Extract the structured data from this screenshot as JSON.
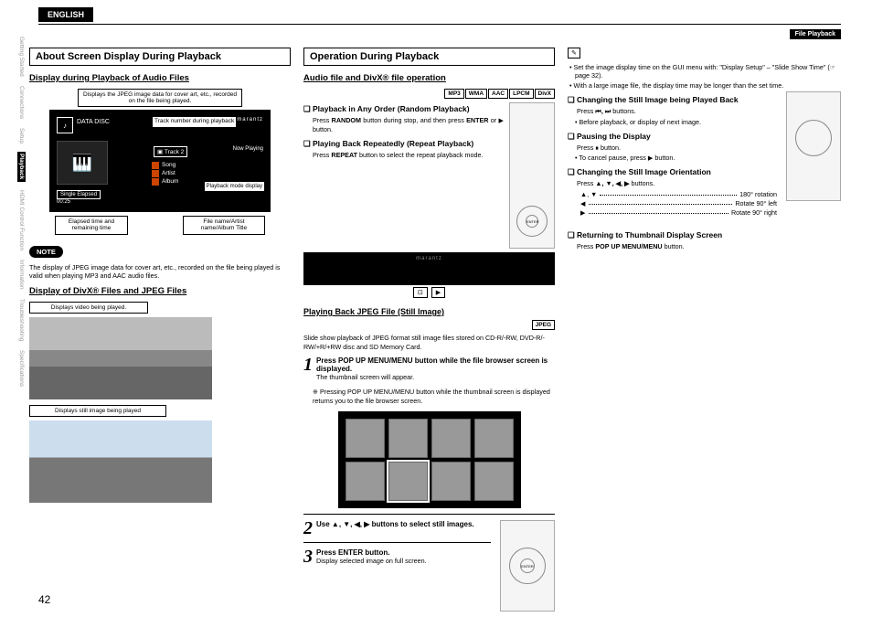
{
  "lang": "ENGLISH",
  "fileplayback": "File Playback",
  "pagenum": "42",
  "sidebar": {
    "items": [
      "Getting Started",
      "Connections",
      "Setup",
      "Playback",
      "HDMI Control Function",
      "Information",
      "Troubleshooting",
      "Specifications"
    ]
  },
  "col1": {
    "title": "About Screen Display During Playback",
    "sub1": "Display during Playback of Audio Files",
    "callout_top": "Displays the JPEG image data for cover art, etc., recorded on the file being played.",
    "display": {
      "disc": "DATA DISC",
      "tracknum": "Track number during playback",
      "track": "Track 2",
      "now": "Now Playing",
      "song": "Song",
      "artist": "Artist",
      "album": "Album",
      "se_label": "Single Elapsed",
      "se_time": "00:25",
      "pbmode": "Playback mode display",
      "brand": "marantz"
    },
    "under": {
      "a": "Elapsed time and remaining time",
      "b": "File name/Artist name/Album Title"
    },
    "note": "NOTE",
    "notetxt": "The display of JPEG image data for cover art, etc., recorded on the file being played is valid when playing MP3 and AAC audio files.",
    "sub2": "Display of DivX® Files and JPEG Files",
    "v_call": "Displays video being played.",
    "s_call": "Displays still image being played"
  },
  "col2": {
    "title": "Operation During Playback",
    "sub1": "Audio file and DivX® file operation",
    "fmts": [
      "MP3",
      "WMA",
      "AAC",
      "LPCM",
      "DivX"
    ],
    "q1": "Playback in Any Order (Random Playback)",
    "q1t": "Press RANDOM button during stop, and then press ENTER or ▶ button.",
    "q2": "Playing Back Repeatedly (Repeat Playback)",
    "q2t": "Press REPEAT button to select the repeat playback mode.",
    "brand": "marantz",
    "sub2": "Playing Back JPEG File (Still Image)",
    "fmt2": "JPEG",
    "slidetxt": "Slide show playback of JPEG format still image files stored on CD-R/-RW, DVD-R/-RW/+R/+RW disc and SD Memory Card.",
    "s1": "Press POP UP MENU/MENU button while the file browser screen is displayed.",
    "s1b": "The thumbnail screen will appear.",
    "s1c": "※ Pressing POP UP MENU/MENU button while the thumbnail screen is displayed returns you to the file browser screen.",
    "s2": "Use ▲, ▼, ◀, ▶ buttons to select still images.",
    "s3": "Press ENTER button.",
    "s3b": "Display selected image on full screen.",
    "enter": "ENTER"
  },
  "col3": {
    "pencil": "✎",
    "bul1": "Set the image display time on the GUI menu with: \"Display Setup\" – \"Slide Show Time\" (☞page 32).",
    "bul2": "With a large image file, the display time may be longer than the set time.",
    "q1": "Changing the Still Image being Played Back",
    "q1a": "Press ⏮, ⏭ buttons.",
    "q1b": "Before playback, or display of next image.",
    "q2": "Pausing the Display",
    "q2a": "Press ⏸ button.",
    "q2b": "To cancel pause, press ▶ button.",
    "q3": "Changing the Still Image Orientation",
    "q3a": "Press ▲, ▼, ◀, ▶ buttons.",
    "r1a": "▲, ▼",
    "r1b": "180° rotation",
    "r2a": "◀",
    "r2b": "Rotate 90° left",
    "r3a": "▶",
    "r3b": "Rotate 90° right",
    "q4": "Returning to Thumbnail Display Screen",
    "q4a": "Press POP UP MENU/MENU button."
  }
}
